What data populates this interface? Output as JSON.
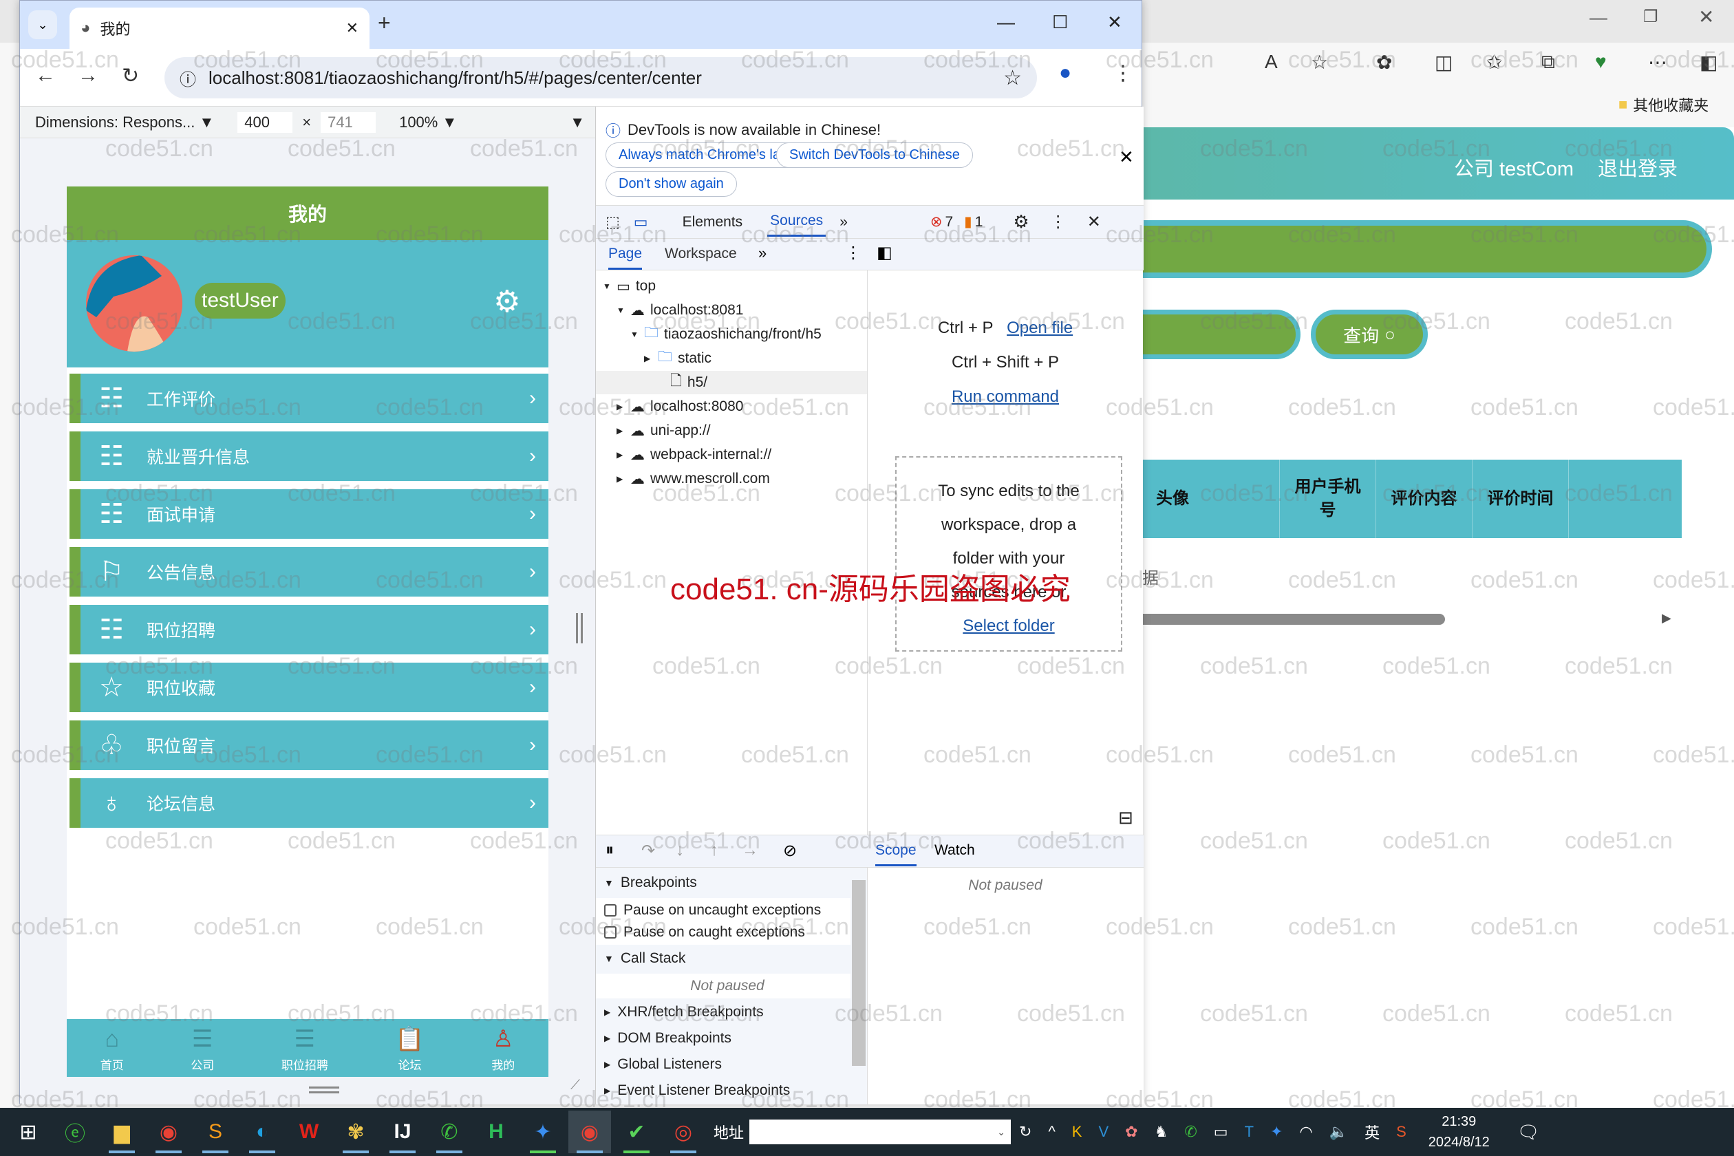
{
  "background_window": {
    "header_company": "公司 testCom",
    "header_logout": "退出登录",
    "query_button": "查询",
    "table_headers": [
      "头像",
      "用户手机号",
      "评价内容",
      "评价时间",
      ""
    ],
    "empty_text": "据",
    "bookmark_folder": "其他收藏夹"
  },
  "browser": {
    "tab_title": "我的",
    "url": "localhost:8081/tiaozaoshichang/front/h5/#/pages/center/center"
  },
  "device_toolbar": {
    "dimensions_label": "Dimensions: Respons...",
    "width": "400",
    "height": "741",
    "zoom": "100%"
  },
  "mobile": {
    "page_title": "我的",
    "username": "testUser",
    "menu": [
      {
        "label": "工作评价",
        "icon": "list-icon"
      },
      {
        "label": "就业晋升信息",
        "icon": "list-icon"
      },
      {
        "label": "面试申请",
        "icon": "list-icon"
      },
      {
        "label": "公告信息",
        "icon": "flag-icon"
      },
      {
        "label": "职位招聘",
        "icon": "list-icon"
      },
      {
        "label": "职位收藏",
        "icon": "star-icon"
      },
      {
        "label": "职位留言",
        "icon": "tulip-icon"
      },
      {
        "label": "论坛信息",
        "icon": "money-bag-icon"
      }
    ],
    "tabbar": [
      {
        "label": "首页",
        "icon": "home-icon"
      },
      {
        "label": "公司",
        "icon": "list-icon"
      },
      {
        "label": "职位招聘",
        "icon": "list-icon"
      },
      {
        "label": "论坛",
        "icon": "clipboard-icon"
      },
      {
        "label": "我的",
        "icon": "user-icon"
      }
    ]
  },
  "devtools": {
    "info_message": "DevTools is now available in Chinese!",
    "btn_always_match": "Always match Chrome's language",
    "btn_switch": "Switch DevTools to Chinese",
    "btn_dont_show": "Don't show again",
    "tabs": [
      "Elements",
      "Sources"
    ],
    "active_tab": "Sources",
    "error_count": "7",
    "warning_count": "1",
    "subtabs": [
      "Page",
      "Workspace"
    ],
    "tree": [
      {
        "label": "top",
        "depth": 0,
        "arrow": "▼",
        "icon": "frame"
      },
      {
        "label": "localhost:8081",
        "depth": 1,
        "arrow": "▼",
        "icon": "cloud"
      },
      {
        "label": "tiaozaoshichang/front/h5",
        "depth": 2,
        "arrow": "▼",
        "icon": "folder"
      },
      {
        "label": "static",
        "depth": 3,
        "arrow": "▶",
        "icon": "folder"
      },
      {
        "label": "h5/",
        "depth": 3,
        "arrow": "",
        "icon": "file"
      },
      {
        "label": "localhost:8080",
        "depth": 1,
        "arrow": "▶",
        "icon": "cloud"
      },
      {
        "label": "uni-app://",
        "depth": 1,
        "arrow": "▶",
        "icon": "cloud"
      },
      {
        "label": "webpack-internal://",
        "depth": 1,
        "arrow": "▶",
        "icon": "cloud"
      },
      {
        "label": "www.mescroll.com",
        "depth": 1,
        "arrow": "▶",
        "icon": "cloud"
      }
    ],
    "shortcut1_keys": "Ctrl + P",
    "shortcut1_action": "Open file",
    "shortcut2_keys": "Ctrl + Shift + P",
    "shortcut2_action": "Run command",
    "dropzone_text": "To sync edits to the workspace, drop a folder with your sources here or",
    "dropzone_link": "Select folder",
    "scope_tab": "Scope",
    "watch_tab": "Watch",
    "not_paused": "Not paused",
    "breakpoints_header": "Breakpoints",
    "pause_uncaught": "Pause on uncaught exceptions",
    "pause_caught": "Pause on caught exceptions",
    "call_stack": "Call Stack",
    "sections": [
      "XHR/fetch Breakpoints",
      "DOM Breakpoints",
      "Global Listeners",
      "Event Listener Breakpoints"
    ]
  },
  "watermark": {
    "small": "code51.cn",
    "big": "code51. cn-源码乐园盗图必究"
  },
  "taskbar": {
    "address_label": "地址",
    "ime": "英",
    "time": "21:39",
    "date": "2024/8/12"
  }
}
